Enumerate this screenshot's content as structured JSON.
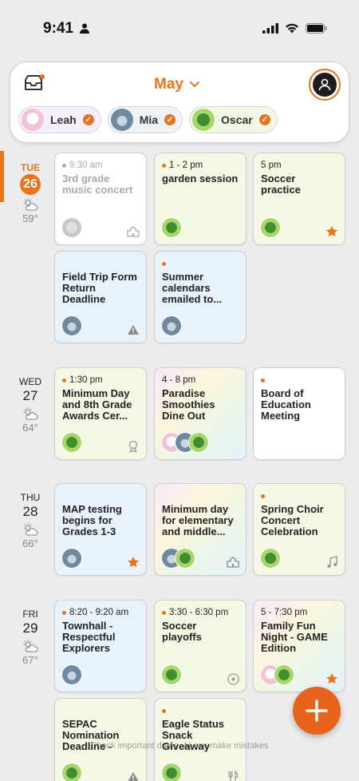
{
  "status_bar": {
    "time": "9:41"
  },
  "header": {
    "month": "May",
    "people": [
      {
        "name": "Leah",
        "avatar": "cow-avatar"
      },
      {
        "name": "Mia",
        "avatar": "shark-avatar"
      },
      {
        "name": "Oscar",
        "avatar": "dino-avatar"
      }
    ]
  },
  "days": [
    {
      "dow": "TUE",
      "date": "26",
      "temp": "59°",
      "weather": "partly-sunny-icon",
      "today": true
    },
    {
      "dow": "WED",
      "date": "27",
      "temp": "64°",
      "weather": "partly-sunny-icon"
    },
    {
      "dow": "THU",
      "date": "28",
      "temp": "66°",
      "weather": "partly-sunny-icon"
    },
    {
      "dow": "FRI",
      "date": "29",
      "temp": "67°",
      "weather": "partly-sunny-icon"
    }
  ],
  "events": {
    "tue": [
      {
        "time": "9:30 am",
        "title": "3rd grade music concert",
        "people": [
          "ghost"
        ],
        "icon": "school-icon",
        "past": true
      },
      {
        "time": "1 - 2 pm",
        "title": "garden session",
        "people": [
          "dino"
        ]
      },
      {
        "time": "5 pm",
        "title": "Soccer practice",
        "people": [
          "dino"
        ],
        "icon": "star-icon"
      },
      {
        "time": "",
        "title": "Field Trip Form Return Deadline",
        "people": [
          "shark"
        ],
        "icon": "warning-icon"
      },
      {
        "time": "",
        "title": "Summer calendars emailed to...",
        "people": [
          "shark"
        ]
      }
    ],
    "wed": [
      {
        "time": "1:30 pm",
        "title": "Minimum Day and 8th Grade Awards Cer...",
        "people": [
          "dino"
        ],
        "icon": "award-icon"
      },
      {
        "time": "4 - 8 pm",
        "title": "Paradise Smoothies Dine Out",
        "people": [
          "cow",
          "shark",
          "dino"
        ]
      },
      {
        "time": "",
        "title": "Board of Education Meeting",
        "people": []
      }
    ],
    "thu": [
      {
        "time": "",
        "title": "MAP testing begins for Grades 1-3",
        "people": [
          "shark"
        ],
        "icon": "star-icon"
      },
      {
        "time": "",
        "title": "Minimum day for elementary and middle...",
        "people": [
          "shark",
          "dino"
        ],
        "icon": "school-icon"
      },
      {
        "time": "",
        "title": "Spring Choir Concert Celebration",
        "people": [
          "dino"
        ],
        "icon": "music-note-icon"
      }
    ],
    "fri": [
      {
        "time": "8:20 - 9:20 am",
        "title": "Townhall - Respectful Explorers",
        "people": [
          "shark"
        ]
      },
      {
        "time": "3:30 - 6:30 pm",
        "title": "Soccer playoffs",
        "people": [
          "dino"
        ],
        "icon": "soccer-ball-icon"
      },
      {
        "time": "5 - 7:30 pm",
        "title": "Family Fun Night - GAME Edition",
        "people": [
          "cow",
          "dino"
        ],
        "icon": "star-icon"
      },
      {
        "time": "",
        "title": "SEPAC Nomination Deadline - Adam...",
        "people": [
          "dino"
        ],
        "icon": "warning-icon"
      },
      {
        "time": "",
        "title": "Eagle Status Snack Giveaway",
        "people": [
          "dino"
        ],
        "icon": "fork-knife-icon"
      }
    ]
  },
  "hint": "Check important dates. AI can make mistakes",
  "colors": {
    "accent": "#e8741c",
    "fab": "#e8641c"
  }
}
